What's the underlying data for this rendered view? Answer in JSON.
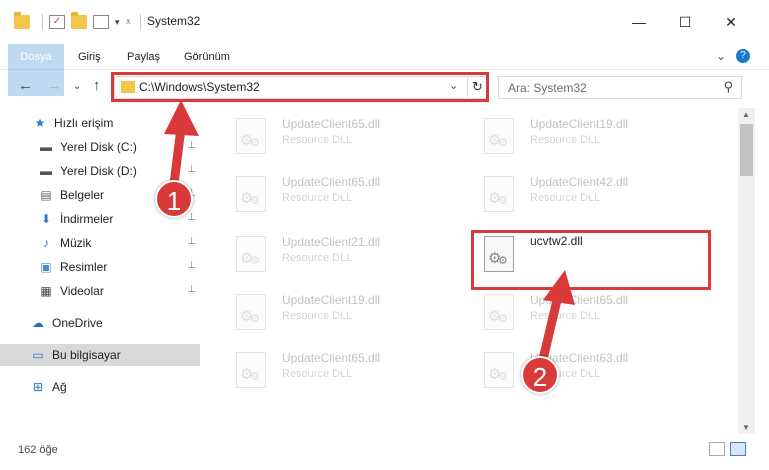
{
  "window": {
    "title": "System32",
    "minimize_glyph": "—",
    "maximize_glyph": "☐",
    "close_glyph": "✕"
  },
  "ribbon": {
    "tabs": [
      "Dosya",
      "Giriş",
      "Paylaş",
      "Görünüm"
    ],
    "expand_glyph": "⌄",
    "help_glyph": "?"
  },
  "address": {
    "path": "C:\\Windows\\System32",
    "search_placeholder": "Ara: System32",
    "back_glyph": "←",
    "forward_glyph": "→",
    "recent_glyph": "⌄",
    "up_glyph": "↑",
    "dropdown_glyph": "⌄",
    "refresh_glyph": "↻",
    "search_glyph": "⚲"
  },
  "sidebar": {
    "items": [
      {
        "label": "Hızlı erişim",
        "icon": "star-icon",
        "glyph": "★",
        "pinned": false
      },
      {
        "label": "Yerel Disk (C:)",
        "icon": "drive-icon",
        "glyph": "▬",
        "pinned": true
      },
      {
        "label": "Yerel Disk (D:)",
        "icon": "drive-icon",
        "glyph": "▬",
        "pinned": true
      },
      {
        "label": "Belgeler",
        "icon": "documents-icon",
        "glyph": "▤",
        "pinned": true
      },
      {
        "label": "İndirmeler",
        "icon": "download-icon",
        "glyph": "⬇",
        "pinned": true
      },
      {
        "label": "Müzik",
        "icon": "music-icon",
        "glyph": "♪",
        "pinned": true
      },
      {
        "label": "Resimler",
        "icon": "pictures-icon",
        "glyph": "▣",
        "pinned": true
      },
      {
        "label": "Videolar",
        "icon": "video-icon",
        "glyph": "▦",
        "pinned": true
      },
      {
        "label": "OneDrive",
        "icon": "cloud-icon",
        "glyph": "☁",
        "pinned": false
      },
      {
        "label": "Bu bilgisayar",
        "icon": "computer-icon",
        "glyph": "▭",
        "pinned": false
      },
      {
        "label": "Ağ",
        "icon": "network-icon",
        "glyph": "⊞",
        "pinned": false
      }
    ],
    "pin_glyph": "📌"
  },
  "files": [
    {
      "name": "UpdateClient65.dll",
      "type": "Resource DLL"
    },
    {
      "name": "UpdateClient19.dll",
      "type": "Resource DLL"
    },
    {
      "name": "UpdateClient65.dll",
      "type": "Resource DLL"
    },
    {
      "name": "UpdateClient42.dll",
      "type": "Resource DLL"
    },
    {
      "name": "UpdateClient21.dll",
      "type": "Resource DLL"
    },
    {
      "name": "ucvtw2.dll",
      "type": ""
    },
    {
      "name": "UpdateClient19.dll",
      "type": "Resource DLL"
    },
    {
      "name": "UpdateClient65.dll",
      "type": "Resource DLL"
    },
    {
      "name": "UpdateClient65.dll",
      "type": "Resource DLL"
    },
    {
      "name": "UpdateClient63.dll",
      "type": "Resource DLL"
    }
  ],
  "status": {
    "count": "162 öğe"
  },
  "annotations": {
    "marker_1": "1",
    "marker_2": "2",
    "color": "#d83a3a"
  }
}
